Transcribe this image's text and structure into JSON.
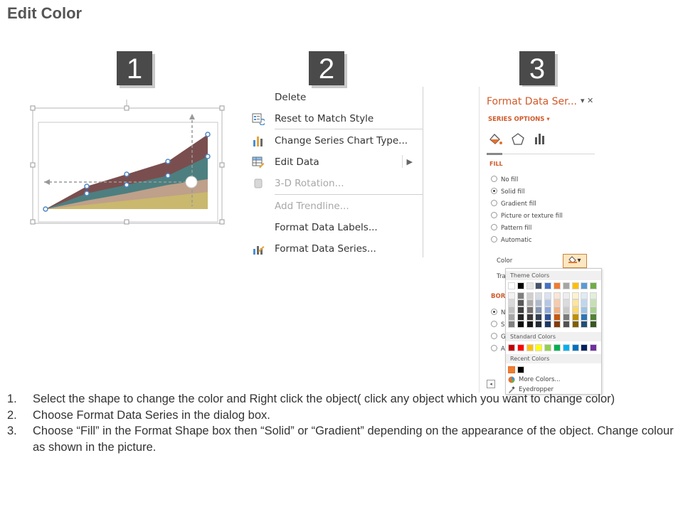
{
  "page": {
    "title": "Edit Color"
  },
  "steps_badges": [
    "1",
    "2",
    "3"
  ],
  "context_menu": {
    "items": [
      {
        "label": "Delete",
        "icon": "none",
        "disabled": false
      },
      {
        "label": "Reset to Match Style",
        "icon": "reset-style-icon",
        "disabled": false
      },
      {
        "label": "Change Series Chart Type...",
        "icon": "bar-chart-icon",
        "disabled": false
      },
      {
        "label": "Edit Data",
        "icon": "table-edit-icon",
        "disabled": false,
        "submenu": true
      },
      {
        "label": "3-D Rotation...",
        "icon": "rotation-3d-icon",
        "disabled": true
      },
      {
        "label": "Add Trendline...",
        "icon": "none",
        "disabled": true
      },
      {
        "label": "Format Data Labels...",
        "icon": "none",
        "disabled": false
      },
      {
        "label": "Format Data Series...",
        "icon": "format-series-icon",
        "disabled": false
      }
    ],
    "submenu_arrow": "▶"
  },
  "format_pane": {
    "title": "Format Data Ser...",
    "controls": "▾ ✕",
    "series_options": "SERIES OPTIONS ▾",
    "tabs": [
      "fill-line-icon",
      "pentagon-icon",
      "bar-chart-icon"
    ],
    "fill_heading": "FILL",
    "fill_options": [
      {
        "label": "No fill",
        "selected": false
      },
      {
        "label": "Solid fill",
        "selected": true
      },
      {
        "label": "Gradient fill",
        "selected": false
      },
      {
        "label": "Picture or texture fill",
        "selected": false
      },
      {
        "label": "Pattern fill",
        "selected": false
      },
      {
        "label": "Automatic",
        "selected": false
      }
    ],
    "color_label": "Color",
    "color_button": "▾",
    "transparency_label_partial": "Tra",
    "border_heading_partial": "BORI",
    "border_partial_options": [
      "N",
      "S",
      "G",
      "A"
    ]
  },
  "color_palette": {
    "theme_heading": "Theme Colors",
    "theme_top": [
      "#ffffff",
      "#000000",
      "#e7e6e6",
      "#44546a",
      "#4472c4",
      "#ed7d31",
      "#a5a5a5",
      "#ffc000",
      "#5b9bd5",
      "#70ad47"
    ],
    "theme_shades": [
      [
        "#f2f2f2",
        "#7f7f7f",
        "#d0cece",
        "#d6dce4",
        "#d9e2f3",
        "#fbe5d5",
        "#ededed",
        "#fff2cc",
        "#deebf6",
        "#e2efd9"
      ],
      [
        "#d8d8d8",
        "#595959",
        "#aeabab",
        "#adb9ca",
        "#b4c6e7",
        "#f7cbac",
        "#dbdbdb",
        "#fee599",
        "#bdd7ee",
        "#c5e0b3"
      ],
      [
        "#bfbfbf",
        "#3f3f3f",
        "#757070",
        "#8496b0",
        "#8eaadb",
        "#f4b183",
        "#c9c9c9",
        "#ffd965",
        "#9dc3e6",
        "#a8d08d"
      ],
      [
        "#a5a5a5",
        "#262626",
        "#3a3838",
        "#323f4f",
        "#2f5496",
        "#c55a11",
        "#7b7b7b",
        "#bf9000",
        "#2e75b5",
        "#538135"
      ],
      [
        "#7f7f7f",
        "#0c0c0c",
        "#171616",
        "#222a35",
        "#1e3864",
        "#833c0b",
        "#525252",
        "#7f6000",
        "#1f4e79",
        "#375623"
      ]
    ],
    "standard_heading": "Standard Colors",
    "standard": [
      "#c00000",
      "#ff0000",
      "#ffc000",
      "#ffff00",
      "#92d050",
      "#00b050",
      "#00b0f0",
      "#0070c0",
      "#002060",
      "#7030a0"
    ],
    "recent_heading": "Recent Colors",
    "recent": [
      "#ed7d31",
      "#000000"
    ],
    "more_colors": "More Colors...",
    "eyedropper": "Eyedropper"
  },
  "instructions": [
    {
      "num": "1.",
      "text": "Select the shape to change the color and Right click the object( click any object which you want to change color)"
    },
    {
      "num": "2.",
      "text": "Choose Format Data Series in the dialog box."
    },
    {
      "num": "3.",
      "text": "Choose “Fill” in the Format Shape box then “Solid” or “Gradient” depending on the appearance of the object. Change colour as shown in the picture."
    }
  ],
  "chart_colors": {
    "top": "#7a4e4e",
    "mid": "#4d7f80",
    "low": "#bfa08a",
    "base": "#c9b86e"
  }
}
